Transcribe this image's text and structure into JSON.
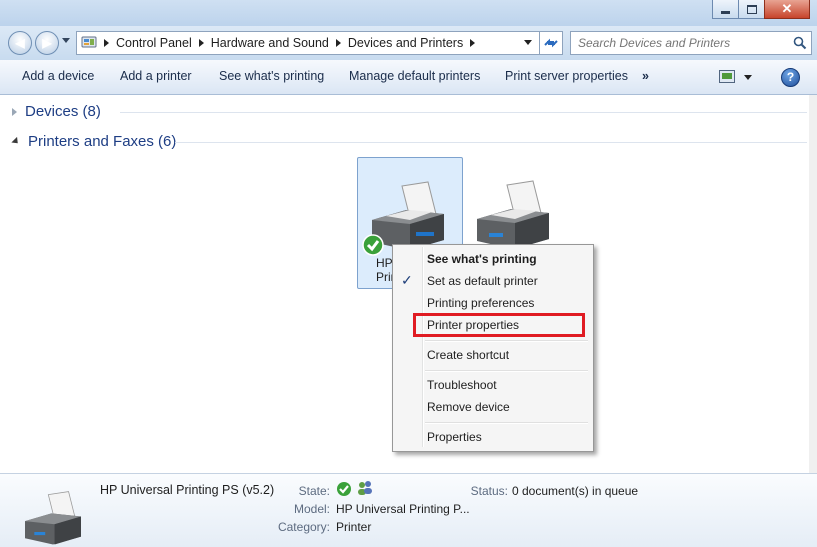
{
  "window": {
    "controls": [
      "minimize",
      "maximize",
      "close"
    ]
  },
  "address": {
    "crumbs": [
      "Control Panel",
      "Hardware and Sound",
      "Devices and Printers"
    ],
    "search_placeholder": "Search Devices and Printers"
  },
  "toolbar": {
    "items": [
      "Add a device",
      "Add a printer",
      "See what's printing",
      "Manage default printers",
      "Print server properties"
    ],
    "overflow": "»"
  },
  "groups": {
    "devices": "Devices (8)",
    "printers": "Printers and Faxes (6)"
  },
  "tiles": {
    "selected_label_line1": "HP",
    "selected_label_line2": "Printi"
  },
  "context_menu": {
    "items": [
      "See what's printing",
      "Set as default printer",
      "Printing preferences",
      "Printer properties",
      "Create shortcut",
      "Troubleshoot",
      "Remove device",
      "Properties"
    ],
    "checkmark": "✓",
    "highlighted": "Printer properties"
  },
  "details": {
    "name": "HP Universal Printing PS (v5.2)",
    "state_label": "State:",
    "model_label": "Model:",
    "model_value": "HP Universal Printing P...",
    "category_label": "Category:",
    "category_value": "Printer",
    "status_label": "Status:",
    "status_value": "0 document(s) in queue"
  },
  "colors": {
    "accent": "#1e3e84",
    "highlight_box": "#e01b22",
    "selection": "#cce4f7"
  }
}
